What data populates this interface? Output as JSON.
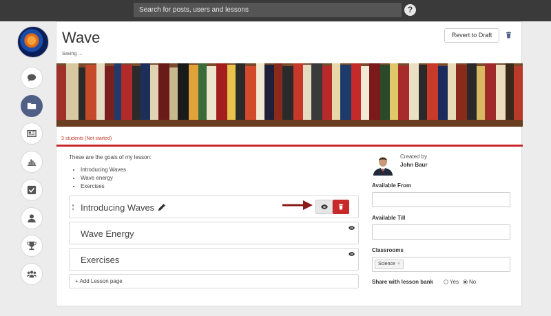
{
  "topbar": {
    "search_placeholder": "Search for posts, users and lessons",
    "help_label": "?"
  },
  "sidebar": {
    "items": [
      {
        "name": "messages",
        "icon": "chat-icon"
      },
      {
        "name": "folder",
        "icon": "folder-icon",
        "active": true
      },
      {
        "name": "news",
        "icon": "newspaper-icon"
      },
      {
        "name": "stats",
        "icon": "bar-chart-icon"
      },
      {
        "name": "tasks",
        "icon": "checkbox-icon"
      },
      {
        "name": "profile",
        "icon": "user-icon"
      },
      {
        "name": "trophies",
        "icon": "trophy-icon"
      },
      {
        "name": "groups",
        "icon": "group-icon"
      }
    ]
  },
  "lesson": {
    "title": "Wave",
    "status": "Saving ...",
    "revert_label": "Revert to Draft",
    "students": "3 students (Not started)",
    "goals_intro": "These are the goals of my lesson:",
    "goals": [
      "Introducing Waves",
      "Wave energy",
      "Exercises"
    ],
    "pages": [
      {
        "label": "Introducing Waves"
      },
      {
        "label": "Wave Energy"
      },
      {
        "label": "Exercises"
      }
    ],
    "add_page_label": "+ Add Lesson page"
  },
  "details": {
    "created_by_label": "Created by",
    "creator_name": "John Baur",
    "available_from_label": "Available From",
    "available_from_value": "",
    "available_till_label": "Available Till",
    "available_till_value": "",
    "classrooms_label": "Classrooms",
    "classroom_tag": "Science",
    "tag_remove": "×",
    "share_label": "Share with lesson bank",
    "share_yes": "Yes",
    "share_no": "No",
    "share_selected": "No"
  },
  "colors": {
    "topbar": "#3a3a3a",
    "accent_red": "#c7282a",
    "sidebar_active": "#4f5f86",
    "arrow": "#8b1a1a"
  }
}
